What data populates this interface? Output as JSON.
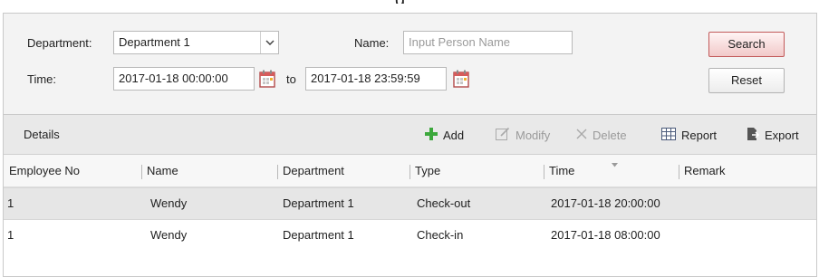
{
  "window": {
    "title_fragment": "g"
  },
  "filters": {
    "department_label": "Department:",
    "department_value": "Department 1",
    "name_label": "Name:",
    "name_placeholder": "Input Person Name",
    "time_label": "Time:",
    "time_from": "2017-01-18 00:00:00",
    "time_to_label": "to",
    "time_to": "2017-01-18 23:59:59",
    "search_label": "Search",
    "reset_label": "Reset"
  },
  "toolbar": {
    "title": "Details",
    "add_label": "Add",
    "modify_label": "Modify",
    "delete_label": "Delete",
    "report_label": "Report",
    "export_label": "Export"
  },
  "table": {
    "columns": [
      "Employee No",
      "Name",
      "Department",
      "Type",
      "Time",
      "Remark"
    ],
    "sorted_column": "Time",
    "rows": [
      {
        "employee_no": "1",
        "name": "Wendy",
        "department": "Department 1",
        "type": "Check-out",
        "time": "2017-01-18 20:00:00",
        "remark": "",
        "selected": true
      },
      {
        "employee_no": "1",
        "name": "Wendy",
        "department": "Department 1",
        "type": "Check-in",
        "time": "2017-01-18 08:00:00",
        "remark": "",
        "selected": false
      }
    ]
  },
  "colors": {
    "accent_red": "#c25a5a",
    "add_green": "#3ca83c",
    "toolbar_bg": "#e9e9e9",
    "selected_row": "#e6e6e6"
  },
  "icons": [
    "chevron-down-icon",
    "calendar-icon",
    "plus-icon",
    "edit-icon",
    "close-icon",
    "report-icon",
    "export-icon",
    "sort-arrow-icon"
  ]
}
